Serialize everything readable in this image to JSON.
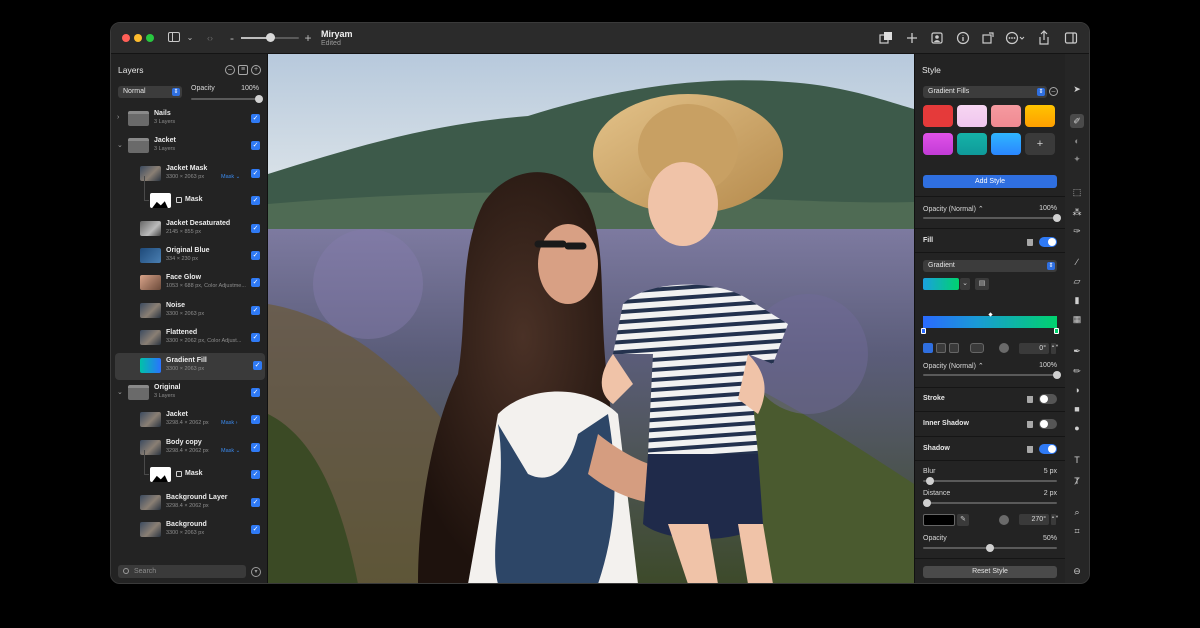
{
  "titlebar": {
    "doc_title": "Miryam",
    "doc_status": "Edited",
    "zoom_minus": "-",
    "zoom_plus": "+"
  },
  "layers_panel": {
    "title": "Layers",
    "blend_mode": "Normal",
    "opacity_label": "Opacity",
    "opacity_value": "100%",
    "opacity_fraction": 1.0,
    "search_placeholder": "Search",
    "layers": [
      {
        "name": "Nails",
        "meta": "3 Layers",
        "kind": "group",
        "thumb": "folder",
        "expanded": false,
        "visible": true
      },
      {
        "name": "Jacket",
        "meta": "3 Layers",
        "kind": "group",
        "thumb": "folder",
        "expanded": true,
        "visible": true
      },
      {
        "name": "Jacket Mask",
        "meta": "3300 × 2063 px",
        "mask_label": "Mask ⌄",
        "kind": "layer",
        "thumb": "photo",
        "visible": true
      },
      {
        "name": "Mask",
        "meta": "",
        "kind": "mask",
        "thumb": "mask",
        "visible": true
      },
      {
        "name": "Jacket Desaturated",
        "meta": "2145 × 855 px",
        "kind": "layer",
        "thumb": "desat",
        "visible": true
      },
      {
        "name": "Original Blue",
        "meta": "334 × 230 px",
        "kind": "layer",
        "thumb": "blue",
        "visible": true
      },
      {
        "name": "Face Glow",
        "meta": "1053 × 688 px, Color Adjustme...",
        "kind": "layer",
        "thumb": "face",
        "visible": true
      },
      {
        "name": "Noise",
        "meta": "3300 × 2063 px",
        "kind": "layer",
        "thumb": "photo",
        "visible": true
      },
      {
        "name": "Flattened",
        "meta": "3300 × 2062 px, Color Adjust...",
        "kind": "layer",
        "thumb": "photo",
        "visible": true
      },
      {
        "name": "Gradient Fill",
        "meta": "3300 × 2063 px",
        "kind": "layer",
        "thumb": "grad",
        "visible": true,
        "selected": true
      },
      {
        "name": "Original",
        "meta": "3 Layers",
        "kind": "group",
        "thumb": "folder",
        "expanded": true,
        "visible": true
      },
      {
        "name": "Jacket",
        "meta": "3298.4 × 2062 px",
        "mask_label": "Mask ›",
        "kind": "layer",
        "thumb": "photo",
        "visible": true
      },
      {
        "name": "Body copy",
        "meta": "3298.4 × 2062 px",
        "mask_label": "Mask ⌄",
        "kind": "layer",
        "thumb": "photo",
        "visible": true
      },
      {
        "name": "Mask",
        "meta": "",
        "kind": "mask",
        "thumb": "mask",
        "visible": true
      },
      {
        "name": "Background Layer",
        "meta": "3298.4 × 2062 px",
        "kind": "layer",
        "thumb": "photo",
        "visible": true
      },
      {
        "name": "Background",
        "meta": "3300 × 2063 px",
        "kind": "layer",
        "thumb": "photo",
        "visible": true
      }
    ]
  },
  "style_panel": {
    "title": "Style",
    "preset_select": "Gradient Fills",
    "swatches": [
      {
        "colors": [
          "#e53a3a",
          "#e53a3a"
        ]
      },
      {
        "colors": [
          "#f7d6f2",
          "#f0c6ee"
        ]
      },
      {
        "colors": [
          "#f59aa0",
          "#f08a92"
        ]
      },
      {
        "colors": [
          "#ffc400",
          "#ff9f00"
        ]
      },
      {
        "colors": [
          "#e052e8",
          "#c23cd6"
        ]
      },
      {
        "colors": [
          "#15b3a8",
          "#0f9a9a"
        ]
      },
      {
        "colors": [
          "#2fb6ff",
          "#2a86ff"
        ]
      }
    ],
    "add_swatch_glyph": "+",
    "add_style_label": "Add Style",
    "opacity_label": "Opacity (Normal) ⌃",
    "opacity_value": "100%",
    "opacity_fraction": 1.0,
    "fill": {
      "title": "Fill",
      "enabled": true,
      "type_select": "Gradient",
      "angle_value": "0°",
      "opacity_label": "Opacity (Normal) ⌃",
      "opacity_value": "100%",
      "opacity_fraction": 1.0,
      "gradient_stops": [
        "#2a6aff",
        "#00d36e"
      ]
    },
    "stroke": {
      "title": "Stroke",
      "enabled": false
    },
    "inner_shadow": {
      "title": "Inner Shadow",
      "enabled": false
    },
    "shadow": {
      "title": "Shadow",
      "enabled": true,
      "blur_label": "Blur",
      "blur_value": "5 px",
      "blur_fraction": 0.05,
      "distance_label": "Distance",
      "distance_value": "2 px",
      "distance_fraction": 0.03,
      "angle_value": "270°",
      "opacity_label": "Opacity",
      "opacity_value": "50%",
      "opacity_fraction": 0.5,
      "color": "#000000"
    },
    "reset_label": "Reset Style"
  },
  "toolbar": {
    "tools": [
      "arrow-icon",
      "style-brush-icon",
      "color-adjust-icon",
      "effects-icon",
      "marquee-icon",
      "magic-wand-icon",
      "quick-select-icon",
      "brush-icon",
      "eraser-icon",
      "fill-bucket-icon",
      "gradient-icon",
      "pen-icon",
      "pencil-icon",
      "shape-icon",
      "rectangle-icon",
      "ellipse-icon",
      "text-icon",
      "type-on-path-icon",
      "zoom-icon",
      "crop-icon",
      "more-icon"
    ]
  },
  "colors": {
    "accent": "#2f6fe0",
    "panel_bg": "#232323",
    "window_bg": "#1e1e1e"
  }
}
